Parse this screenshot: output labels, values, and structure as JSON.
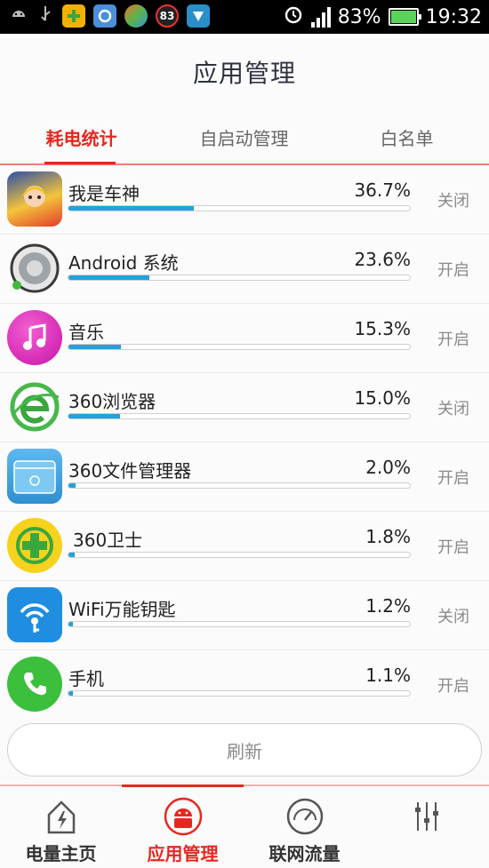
{
  "status_bar": {
    "notif_83": "83",
    "battery_percent": "83%",
    "time": "19:32"
  },
  "header": {
    "title": "应用管理"
  },
  "tabs": [
    {
      "label": "耗电统计",
      "active": true
    },
    {
      "label": "自启动管理",
      "active": false
    },
    {
      "label": "白名单",
      "active": false
    }
  ],
  "apps": [
    {
      "name": "我是车神",
      "percent": "36.7%",
      "usage": 0.367,
      "toggle": "关闭",
      "icon": "racing-game-icon"
    },
    {
      "name": "Android 系统",
      "percent": "23.6%",
      "usage": 0.236,
      "toggle": "开启",
      "icon": "android-system-icon"
    },
    {
      "name": "音乐",
      "percent": "15.3%",
      "usage": 0.153,
      "toggle": "开启",
      "icon": "music-icon"
    },
    {
      "name": "360浏览器",
      "percent": "15.0%",
      "usage": 0.15,
      "toggle": "关闭",
      "icon": "browser-icon"
    },
    {
      "name": "360文件管理器",
      "percent": "2.0%",
      "usage": 0.02,
      "toggle": "开启",
      "icon": "file-manager-icon"
    },
    {
      "name": "360卫士",
      "percent": "1.8%",
      "usage": 0.018,
      "toggle": "开启",
      "icon": "security-guard-icon"
    },
    {
      "name": "WiFi万能钥匙",
      "percent": "1.2%",
      "usage": 0.012,
      "toggle": "关闭",
      "icon": "wifi-key-icon"
    },
    {
      "name": "手机",
      "percent": "1.1%",
      "usage": 0.011,
      "toggle": "开启",
      "icon": "phone-icon"
    }
  ],
  "refresh_label": "刷新",
  "bottom_nav": [
    {
      "label": "电量主页",
      "icon": "battery-home-icon",
      "active": false
    },
    {
      "label": "应用管理",
      "icon": "android-robot-icon",
      "active": true
    },
    {
      "label": "联网流量",
      "icon": "speedometer-icon",
      "active": false
    },
    {
      "label": "",
      "icon": "sliders-icon",
      "active": false
    }
  ],
  "colors": {
    "accent": "#e8261f",
    "progress": "#22a2da"
  }
}
